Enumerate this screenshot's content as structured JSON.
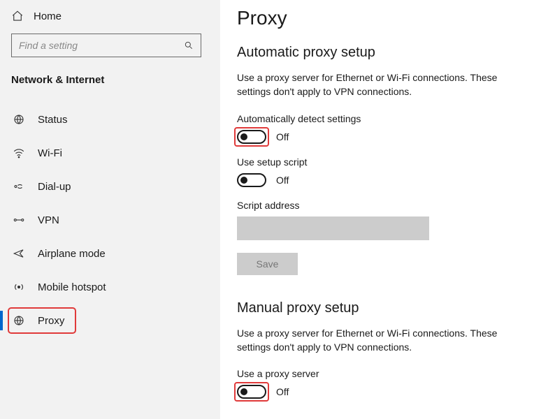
{
  "sidebar": {
    "home_label": "Home",
    "search_placeholder": "Find a setting",
    "category_title": "Network & Internet",
    "items": [
      {
        "label": "Status"
      },
      {
        "label": "Wi-Fi"
      },
      {
        "label": "Dial-up"
      },
      {
        "label": "VPN"
      },
      {
        "label": "Airplane mode"
      },
      {
        "label": "Mobile hotspot"
      },
      {
        "label": "Proxy"
      }
    ]
  },
  "page": {
    "title": "Proxy",
    "auto": {
      "section_title": "Automatic proxy setup",
      "desc": "Use a proxy server for Ethernet or Wi-Fi connections. These settings don't apply to VPN connections.",
      "detect_label": "Automatically detect settings",
      "detect_state": "Off",
      "script_label": "Use setup script",
      "script_state": "Off",
      "address_label": "Script address",
      "address_value": "",
      "save_label": "Save"
    },
    "manual": {
      "section_title": "Manual proxy setup",
      "desc": "Use a proxy server for Ethernet or Wi-Fi connections. These settings don't apply to VPN connections.",
      "use_label": "Use a proxy server",
      "use_state": "Off"
    }
  }
}
